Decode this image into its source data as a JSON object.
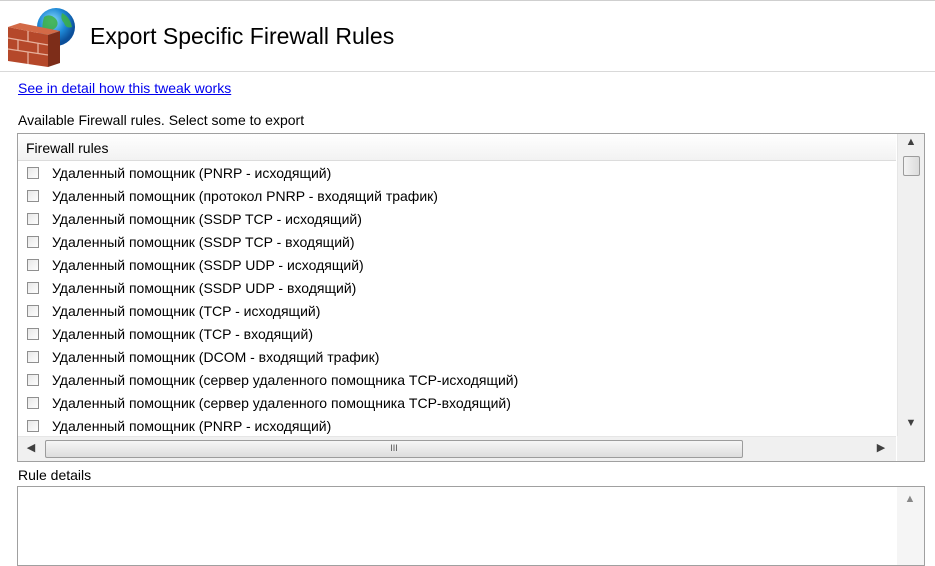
{
  "header": {
    "title": "Export Specific Firewall Rules",
    "icon": "firewall-globe-icon"
  },
  "detail_link": "See in detail how this tweak works",
  "available_label": "Available Firewall rules. Select some to export",
  "list": {
    "column_header": "Firewall rules",
    "rows": [
      {
        "label": "Удаленный помощник (PNRP - исходящий)",
        "checked": false
      },
      {
        "label": "Удаленный помощник (протокол PNRP - входящий трафик)",
        "checked": false
      },
      {
        "label": "Удаленный помощник (SSDP TCP - исходящий)",
        "checked": false
      },
      {
        "label": "Удаленный помощник (SSDP TCP - входящий)",
        "checked": false
      },
      {
        "label": "Удаленный помощник (SSDP UDP - исходящий)",
        "checked": false
      },
      {
        "label": "Удаленный помощник (SSDP UDP - входящий)",
        "checked": false
      },
      {
        "label": "Удаленный помощник (TCP - исходящий)",
        "checked": false
      },
      {
        "label": "Удаленный помощник (TCP - входящий)",
        "checked": false
      },
      {
        "label": "Удаленный помощник (DCOM - входящий трафик)",
        "checked": false
      },
      {
        "label": "Удаленный помощник (сервер удаленного помощника TCP-исходящий)",
        "checked": false
      },
      {
        "label": "Удаленный помощник (сервер удаленного помощника TCP-входящий)",
        "checked": false
      },
      {
        "label": "Удаленный помощник (PNRP - исходящий)",
        "checked": false
      }
    ],
    "hscroll_grip": "III"
  },
  "details_label": "Rule details",
  "colors": {
    "link": "#0000ee",
    "border": "#a0a0a0",
    "scrollbar": "#f0f0f0"
  }
}
